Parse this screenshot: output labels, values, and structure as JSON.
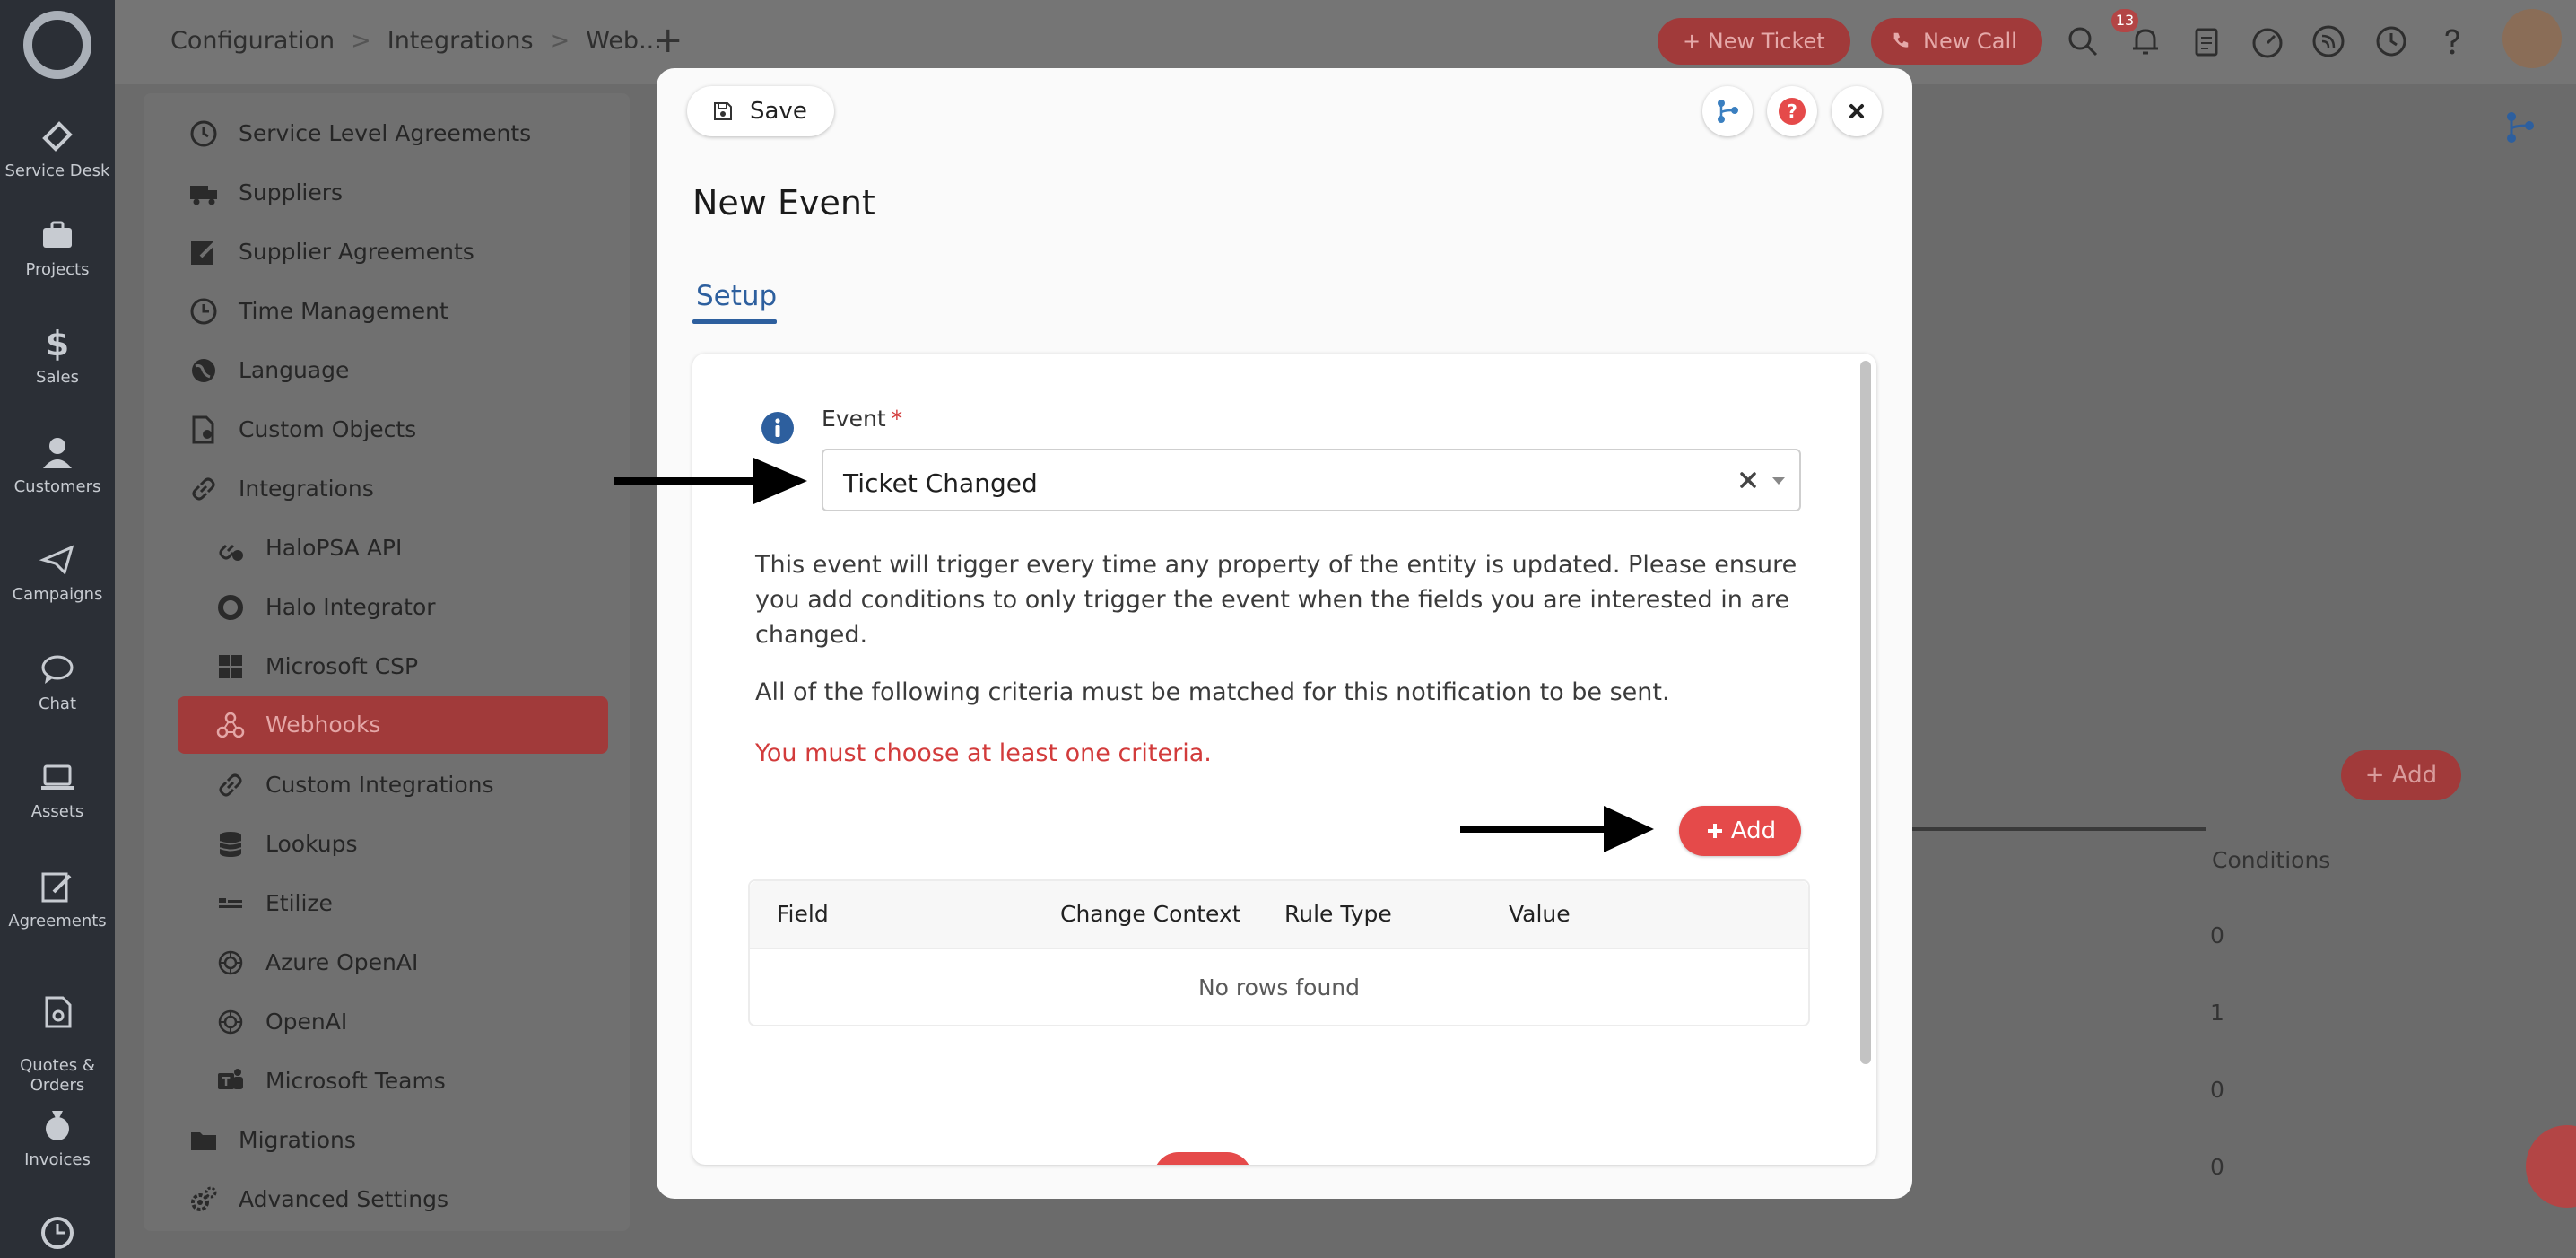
{
  "rail": {
    "items": [
      {
        "label": "Service Desk",
        "icon": "ticket-icon"
      },
      {
        "label": "Projects",
        "icon": "briefcase-icon"
      },
      {
        "label": "Sales",
        "icon": "dollar-icon"
      },
      {
        "label": "Customers",
        "icon": "person-icon"
      },
      {
        "label": "Campaigns",
        "icon": "paper-plane-icon"
      },
      {
        "label": "Chat",
        "icon": "chat-icon"
      },
      {
        "label": "Assets",
        "icon": "laptop-icon"
      },
      {
        "label": "Agreements",
        "icon": "pen-icon"
      },
      {
        "label": "Quotes &\nOrders",
        "icon": "document-icon"
      },
      {
        "label": "Invoices",
        "icon": "money-bag-icon"
      }
    ]
  },
  "breadcrumb": {
    "c1": "Configuration",
    "c2": "Integrations",
    "c3": "Web...",
    "sep": ">"
  },
  "header": {
    "new_tab": "+",
    "new_ticket": "+ New Ticket",
    "new_call": "New Call",
    "notif_count": "13"
  },
  "sidebar": {
    "items": [
      {
        "label": "Service Level Agreements",
        "icon": "timer-icon"
      },
      {
        "label": "Suppliers",
        "icon": "truck-icon"
      },
      {
        "label": "Supplier Agreements",
        "icon": "edit-icon"
      },
      {
        "label": "Time Management",
        "icon": "clock-icon"
      },
      {
        "label": "Language",
        "icon": "globe-icon"
      },
      {
        "label": "Custom Objects",
        "icon": "object-icon"
      },
      {
        "label": "Integrations",
        "icon": "link-icon"
      },
      {
        "label": "HaloPSA API",
        "icon": "api-icon"
      },
      {
        "label": "Halo Integrator",
        "icon": "halo-icon"
      },
      {
        "label": "Microsoft CSP",
        "icon": "windows-icon"
      },
      {
        "label": "Webhooks",
        "icon": "webhook-icon"
      },
      {
        "label": "Custom Integrations",
        "icon": "link-icon"
      },
      {
        "label": "Lookups",
        "icon": "database-icon"
      },
      {
        "label": "Etilize",
        "icon": "etilize-icon"
      },
      {
        "label": "Azure OpenAI",
        "icon": "openai-icon"
      },
      {
        "label": "OpenAI",
        "icon": "openai-icon"
      },
      {
        "label": "Microsoft Teams",
        "icon": "teams-icon"
      },
      {
        "label": "Migrations",
        "icon": "folder-icon"
      },
      {
        "label": "Advanced Settings",
        "icon": "gears-icon"
      }
    ]
  },
  "background": {
    "add_label": "+ Add",
    "conditions_header": "Conditions",
    "conditions_values": [
      "0",
      "1",
      "0",
      "0"
    ]
  },
  "modal": {
    "save_label": "Save",
    "title": "New Event",
    "tab_setup": "Setup",
    "event_label": "Event",
    "required_mark": "*",
    "event_value": "Ticket Changed",
    "description": "This event will trigger every time any property of the entity is updated. Please ensure you add conditions to only trigger the event when the fields you are interested in are changed.",
    "criteria_text": "All of the following criteria must be matched for this notification to be sent.",
    "error_text": "You must choose at least one criteria.",
    "add_label": "Add",
    "table": {
      "columns": [
        "Field",
        "Change Context",
        "Rule Type",
        "Value"
      ],
      "empty_text": "No rows found"
    }
  },
  "colors": {
    "accent_red": "#e54a4a",
    "link_blue": "#2d5f9e",
    "error_red": "#d23b3b"
  }
}
